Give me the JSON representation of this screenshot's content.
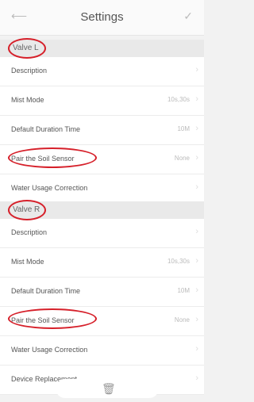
{
  "header": {
    "back_icon": "back-arrow-icon",
    "title": "Settings",
    "confirm_icon": "check-icon"
  },
  "sections": {
    "left": {
      "label": "Valve L",
      "rows": [
        {
          "label": "Description",
          "value": ""
        },
        {
          "label": "Mist Mode",
          "value": "10s,30s"
        },
        {
          "label": "Default Duration Time",
          "value": "10M"
        },
        {
          "label": "Pair the Soil Sensor",
          "value": "None"
        },
        {
          "label": "Water Usage Correction",
          "value": ""
        }
      ]
    },
    "right": {
      "label": "Valve R",
      "rows": [
        {
          "label": "Description",
          "value": ""
        },
        {
          "label": "Mist Mode",
          "value": "10s,30s"
        },
        {
          "label": "Default Duration Time",
          "value": "10M"
        },
        {
          "label": "Pair the Soil Sensor",
          "value": "None"
        },
        {
          "label": "Water Usage Correction",
          "value": ""
        }
      ]
    },
    "device": {
      "label": "Device Replacement"
    }
  },
  "bottom_bar": {
    "icon": "trash-icon"
  },
  "annotation_color": "#d6202a"
}
